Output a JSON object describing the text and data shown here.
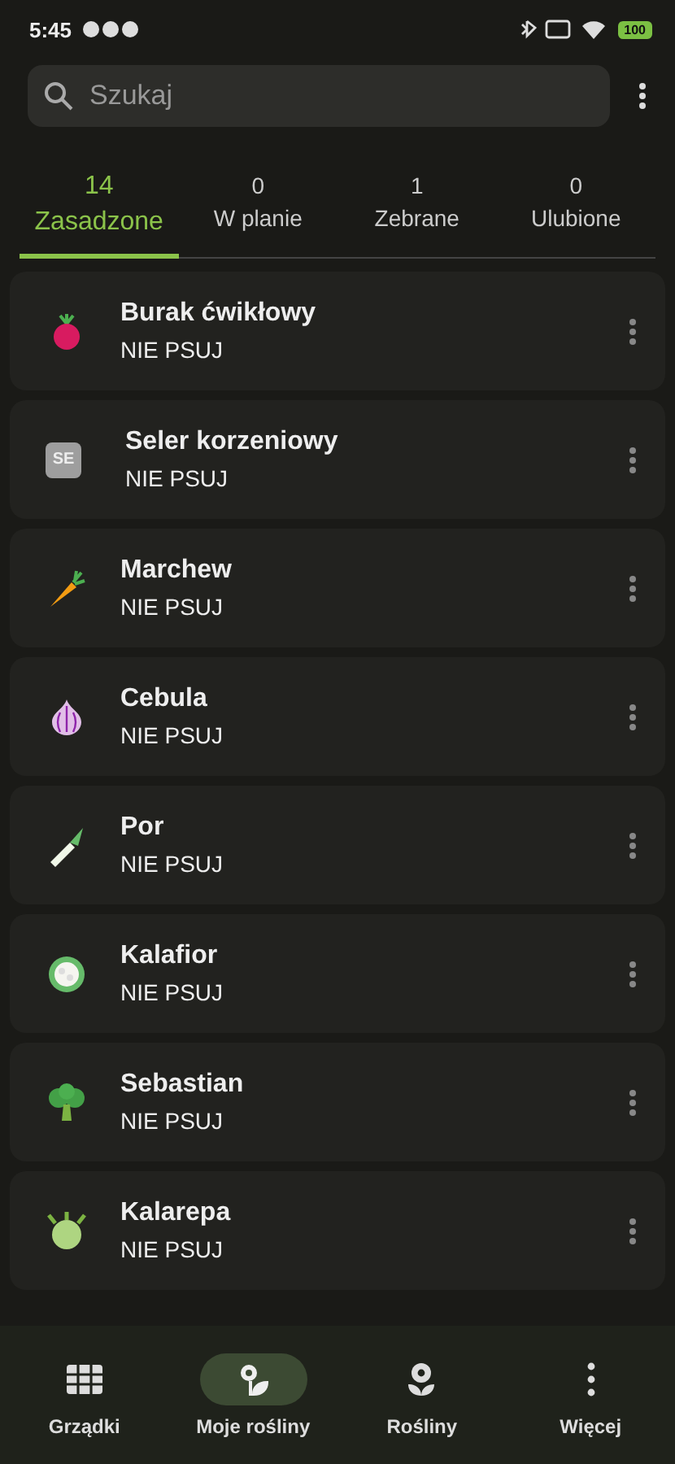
{
  "status_bar": {
    "time": "5:45",
    "battery": "100"
  },
  "search": {
    "placeholder": "Szukaj"
  },
  "tabs": [
    {
      "count": "14",
      "label": "Zasadzone",
      "selected": true
    },
    {
      "count": "0",
      "label": "W planie",
      "selected": false
    },
    {
      "count": "1",
      "label": "Zebrane",
      "selected": false
    },
    {
      "count": "0",
      "label": "Ulubione",
      "selected": false
    }
  ],
  "plants": [
    {
      "kind": "beet",
      "name": "Burak ćwikłowy",
      "status": "NIE PSUJ"
    },
    {
      "kind": "badge",
      "badge": "SE",
      "name": "Seler korzeniowy",
      "status": "NIE PSUJ"
    },
    {
      "kind": "carrot",
      "name": "Marchew",
      "status": "NIE PSUJ"
    },
    {
      "kind": "onion",
      "name": "Cebula",
      "status": "NIE PSUJ"
    },
    {
      "kind": "leek",
      "name": "Por",
      "status": "NIE PSUJ"
    },
    {
      "kind": "cauliflower",
      "name": "Kalafior",
      "status": "NIE PSUJ"
    },
    {
      "kind": "broccoli",
      "name": "Sebastian",
      "status": "NIE PSUJ"
    },
    {
      "kind": "kohlrabi",
      "name": "Kalarepa",
      "status": "NIE PSUJ"
    }
  ],
  "nav": [
    {
      "kind": "grid",
      "label": "Grządki",
      "selected": false
    },
    {
      "kind": "plants",
      "label": "Moje rośliny",
      "selected": true
    },
    {
      "kind": "flower",
      "label": "Rośliny",
      "selected": false
    },
    {
      "kind": "more",
      "label": "Więcej",
      "selected": false
    }
  ]
}
